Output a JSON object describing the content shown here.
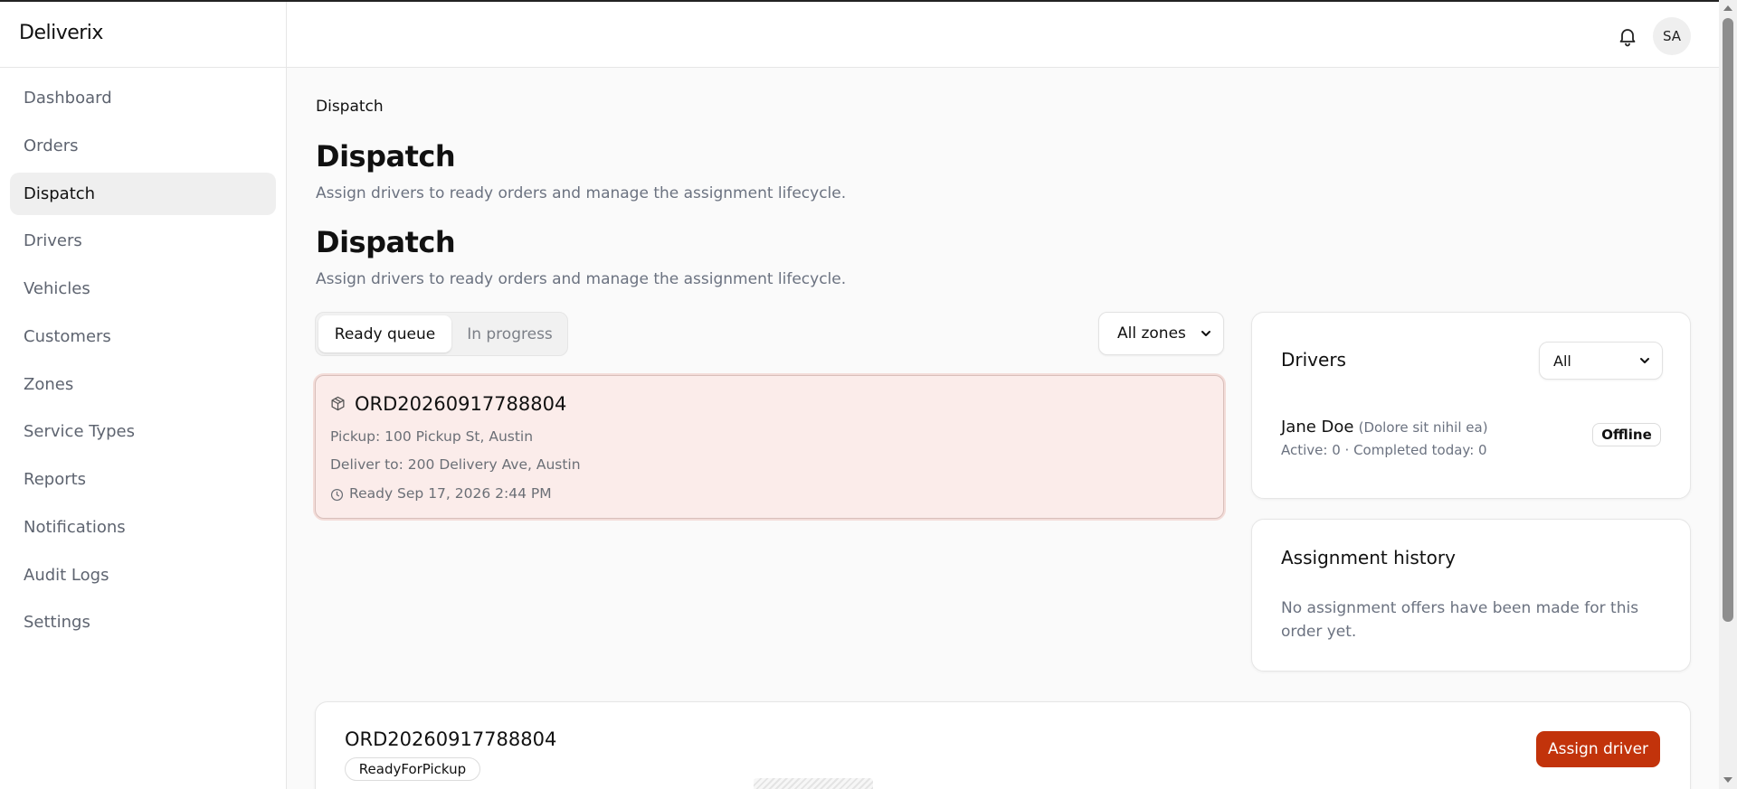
{
  "app": {
    "brand": "Deliverix",
    "avatar_initials": "SA"
  },
  "sidebar": {
    "items": [
      {
        "label": "Dashboard"
      },
      {
        "label": "Orders"
      },
      {
        "label": "Dispatch",
        "active": true
      },
      {
        "label": "Drivers"
      },
      {
        "label": "Vehicles"
      },
      {
        "label": "Customers"
      },
      {
        "label": "Zones"
      },
      {
        "label": "Service Types"
      },
      {
        "label": "Reports"
      },
      {
        "label": "Notifications"
      },
      {
        "label": "Audit Logs"
      },
      {
        "label": "Settings"
      }
    ]
  },
  "page": {
    "breadcrumb": "Dispatch",
    "title": "Dispatch",
    "subtitle": "Assign drivers to ready orders and manage the assignment lifecycle.",
    "title2": "Dispatch",
    "subtitle2": "Assign drivers to ready orders and manage the assignment lifecycle."
  },
  "queue": {
    "tabs": [
      {
        "label": "Ready queue",
        "active": true
      },
      {
        "label": "In progress",
        "active": false
      }
    ],
    "zone_filter": "All zones",
    "orders": [
      {
        "id": "ORD20260917788804",
        "pickup": "Pickup: 100 Pickup St, Austin",
        "deliver": "Deliver to: 200 Delivery Ave, Austin",
        "ready": "Ready Sep 17, 2026 2:44 PM",
        "selected": true
      }
    ]
  },
  "drivers_panel": {
    "title": "Drivers",
    "filter": "All",
    "drivers": [
      {
        "name": "Jane Doe",
        "note": "(Dolore sit nihil ea)",
        "stats": "Active: 0 · Completed today: 0",
        "status": "Offline"
      }
    ]
  },
  "history_panel": {
    "title": "Assignment history",
    "empty_text": "No assignment offers have been made for this order yet."
  },
  "detail": {
    "order_id": "ORD20260917788804",
    "status": "ReadyForPickup",
    "assign_label": "Assign driver"
  },
  "colors": {
    "accent": "#c2330b",
    "selected_card_bg": "#fbecea",
    "nav_active_bg": "#efefef"
  }
}
